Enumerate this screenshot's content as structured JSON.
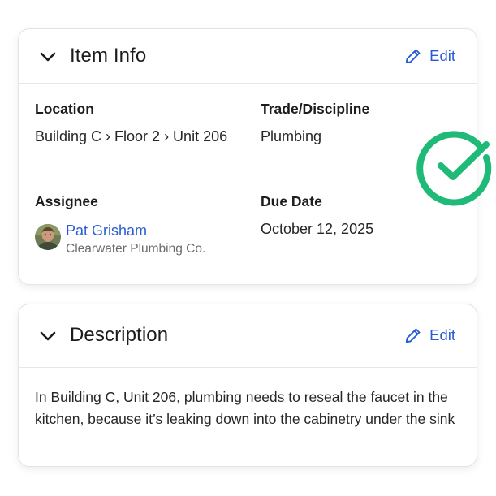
{
  "item_info": {
    "title": "Item Info",
    "edit_label": "Edit",
    "location": {
      "label": "Location",
      "value": "Building C › Floor 2 › Unit 206"
    },
    "trade": {
      "label": "Trade/Discipline",
      "value": "Plumbing"
    },
    "assignee": {
      "label": "Assignee",
      "name": "Pat Grisham",
      "company": "Clearwater Plumbing Co."
    },
    "due_date": {
      "label": "Due Date",
      "value": "October 12, 2025"
    }
  },
  "description": {
    "title": "Description",
    "edit_label": "Edit",
    "text": "In Building C, Unit 206, plumbing needs to reseal the faucet in the kitchen, because it’s leaking down into the cabinetry under the sink"
  },
  "colors": {
    "accent": "#2a5bd7",
    "success": "#1fb978"
  },
  "icons": {
    "collapse": "chevron-down-icon",
    "edit": "pencil-icon",
    "status": "check-circle-icon"
  }
}
